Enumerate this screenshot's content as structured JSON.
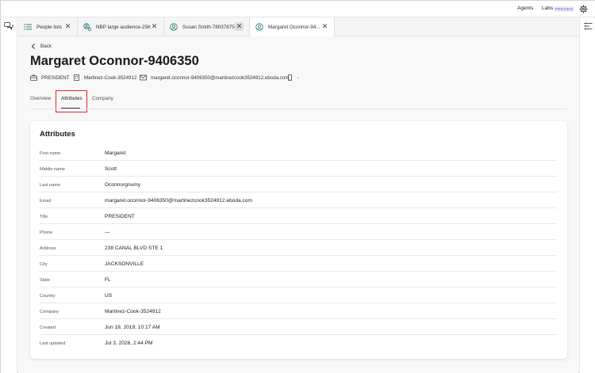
{
  "topbar": {
    "agents": "Agents",
    "labs": "Labs",
    "preview": "PREVIEW",
    "settings_icon": "gear-icon"
  },
  "tabs": [
    {
      "label": "People lists",
      "icon": "list-icon",
      "active": false
    },
    {
      "label": "NBP large audience-25K",
      "icon": "audience-icon",
      "active": false
    },
    {
      "label": "Susan Smith-780378757",
      "icon": "person-icon",
      "active": false
    },
    {
      "label": "Margaret Oconnor-94...",
      "icon": "person-icon",
      "active": true
    }
  ],
  "back_label": "Back",
  "page_title": "Margaret Oconnor-9406350",
  "meta": {
    "title": "PRESIDENT",
    "company": "Martinez-Cook-3524912",
    "email": "margaret.oconnor-9406350@martinezcook3524912.eboda.com",
    "phone": "-"
  },
  "subtabs": [
    "Overview",
    "Attributes",
    "Company"
  ],
  "selected_subtab": "Attributes",
  "highlight_color": "#d7272c",
  "card": {
    "heading": "Attributes",
    "rows": [
      {
        "key": "First name",
        "value": "Margaret"
      },
      {
        "key": "Middle name",
        "value": "Scott"
      },
      {
        "key": "Last name",
        "value": "Oconnorgnumy"
      },
      {
        "key": "Email",
        "value": "margaret.oconnor-9406350@martinezcook3524912.eboda.com"
      },
      {
        "key": "Title",
        "value": "PRESIDENT"
      },
      {
        "key": "Phone",
        "value": "—"
      },
      {
        "key": "Address",
        "value": "238 CANAL BLVD STE 1"
      },
      {
        "key": "City",
        "value": "JACKSONVILLE"
      },
      {
        "key": "State",
        "value": "FL"
      },
      {
        "key": "Country",
        "value": "US"
      },
      {
        "key": "Company",
        "value": "Martinez-Cook-3524912"
      },
      {
        "key": "Created",
        "value": "Jun 19, 2019, 10:17 AM"
      },
      {
        "key": "Last updated",
        "value": "Jul 3, 2026, 2:44 PM"
      }
    ]
  }
}
